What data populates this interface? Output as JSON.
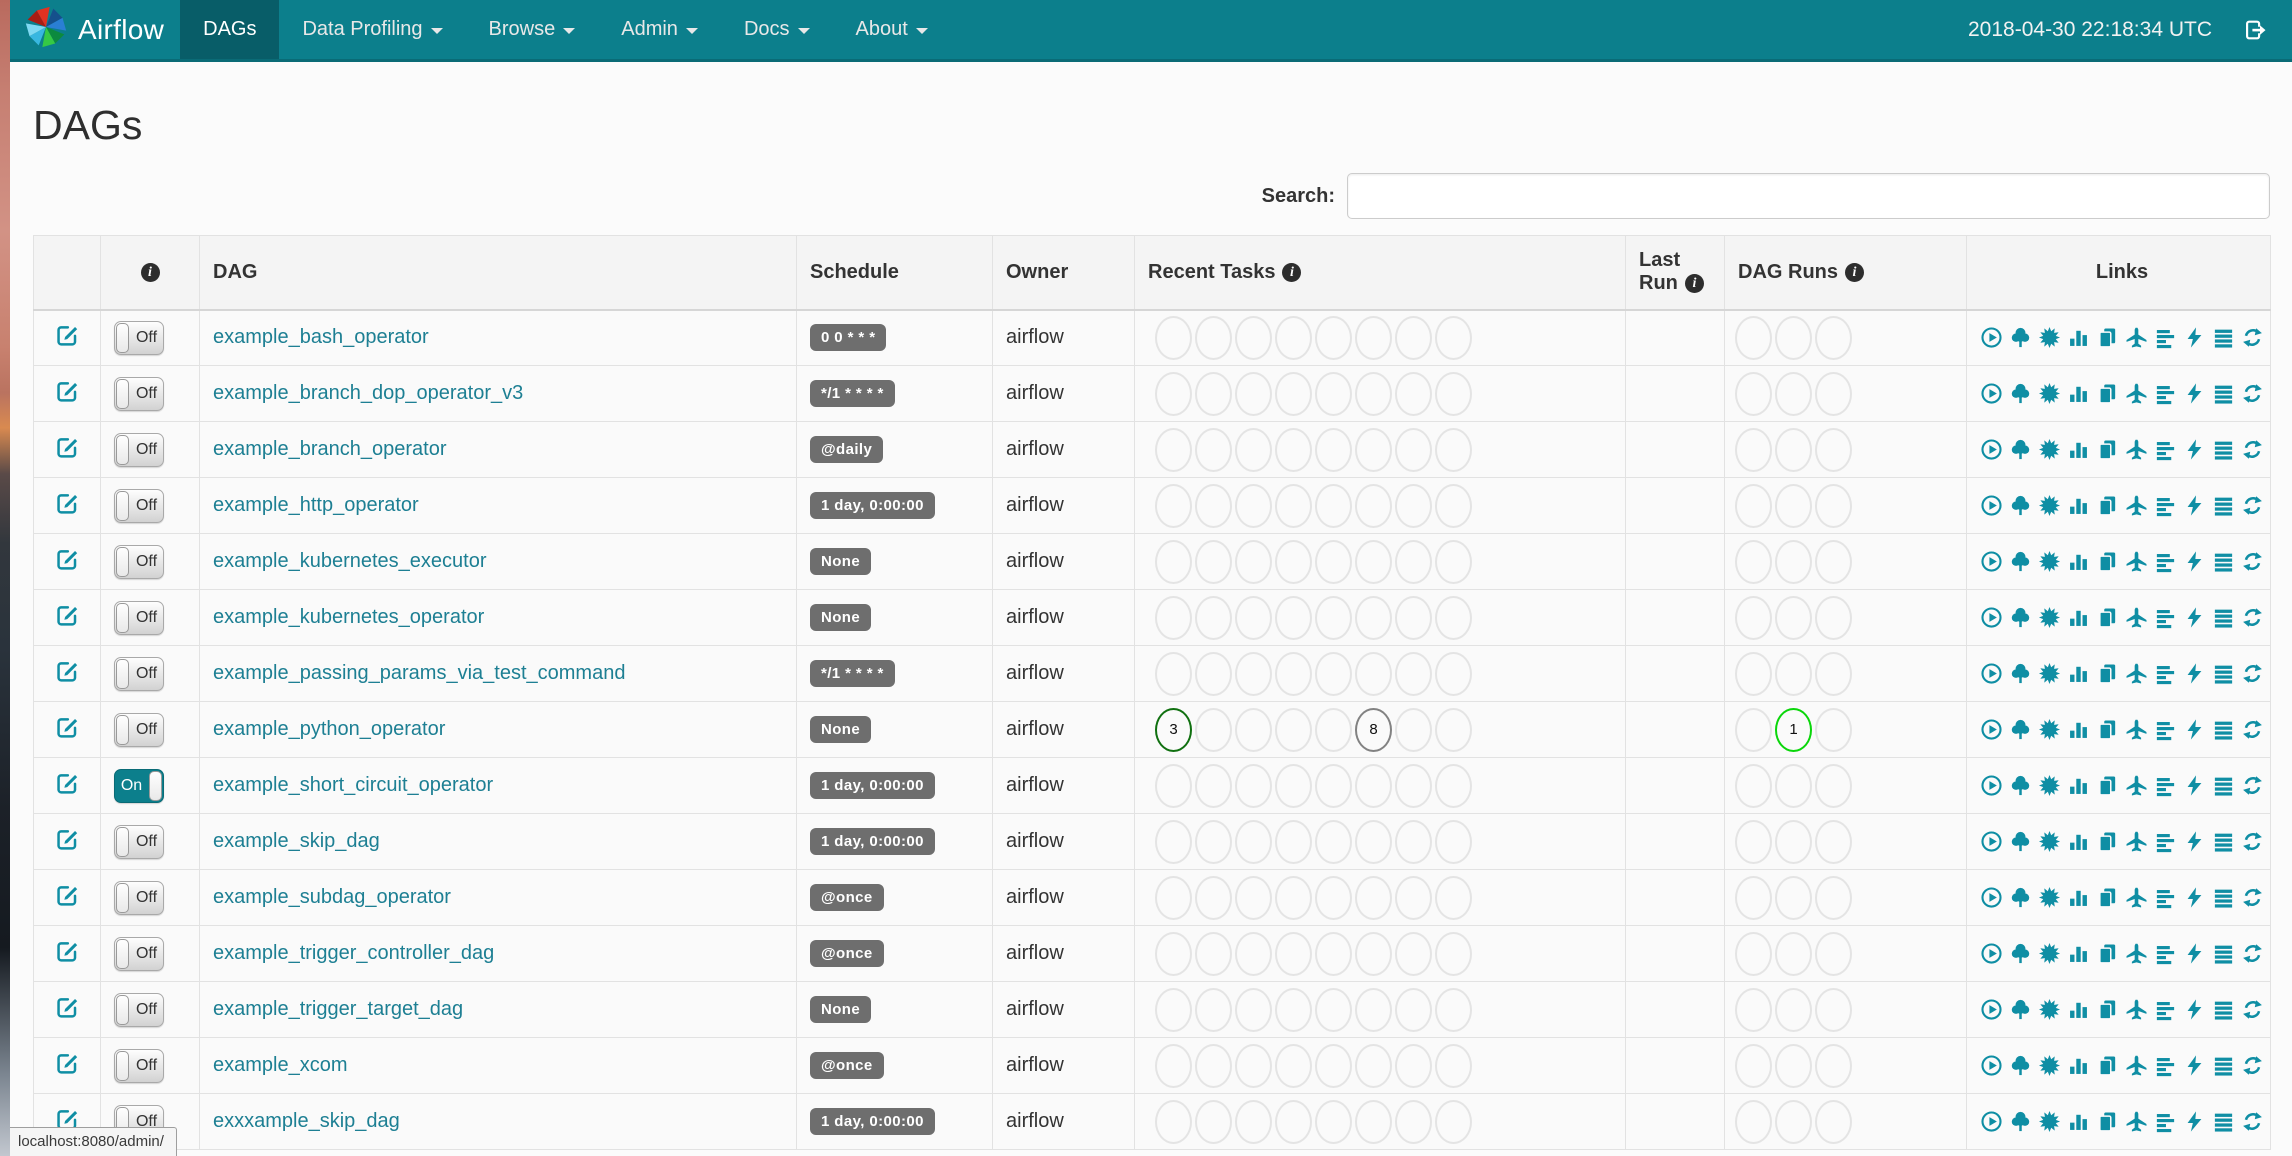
{
  "navbar": {
    "brand": "Airflow",
    "items": [
      {
        "label": "DAGs",
        "active": true,
        "caret": false
      },
      {
        "label": "Data Profiling",
        "active": false,
        "caret": true
      },
      {
        "label": "Browse",
        "active": false,
        "caret": true
      },
      {
        "label": "Admin",
        "active": false,
        "caret": true
      },
      {
        "label": "Docs",
        "active": false,
        "caret": true
      },
      {
        "label": "About",
        "active": false,
        "caret": true
      }
    ],
    "clock": "2018-04-30 22:18:34 UTC"
  },
  "page": {
    "title": "DAGs",
    "search_label": "Search:",
    "search_value": "",
    "status_bar_url": "localhost:8080/admin/"
  },
  "table": {
    "headers": {
      "edit": "",
      "dag": "DAG",
      "schedule": "Schedule",
      "owner": "Owner",
      "recent_tasks": "Recent Tasks",
      "last_run": "Last Run",
      "dag_runs": "DAG Runs",
      "links": "Links"
    },
    "recent_task_slots": 8,
    "dag_run_slots": 3,
    "rows": [
      {
        "name": "example_bash_operator",
        "toggle": "Off",
        "schedule": "0 0 * * *",
        "owner": "airflow",
        "last_run": "",
        "recent_tasks": [],
        "dag_runs": []
      },
      {
        "name": "example_branch_dop_operator_v3",
        "toggle": "Off",
        "schedule": "*/1 * * * *",
        "owner": "airflow",
        "last_run": "",
        "recent_tasks": [],
        "dag_runs": []
      },
      {
        "name": "example_branch_operator",
        "toggle": "Off",
        "schedule": "@daily",
        "owner": "airflow",
        "last_run": "",
        "recent_tasks": [],
        "dag_runs": []
      },
      {
        "name": "example_http_operator",
        "toggle": "Off",
        "schedule": "1 day, 0:00:00",
        "owner": "airflow",
        "last_run": "",
        "recent_tasks": [],
        "dag_runs": []
      },
      {
        "name": "example_kubernetes_executor",
        "toggle": "Off",
        "schedule": "None",
        "owner": "airflow",
        "last_run": "",
        "recent_tasks": [],
        "dag_runs": []
      },
      {
        "name": "example_kubernetes_operator",
        "toggle": "Off",
        "schedule": "None",
        "owner": "airflow",
        "last_run": "",
        "recent_tasks": [],
        "dag_runs": []
      },
      {
        "name": "example_passing_params_via_test_command",
        "toggle": "Off",
        "schedule": "*/1 * * * *",
        "owner": "airflow",
        "last_run": "",
        "recent_tasks": [],
        "dag_runs": []
      },
      {
        "name": "example_python_operator",
        "toggle": "Off",
        "schedule": "None",
        "owner": "airflow",
        "last_run": "",
        "recent_tasks": [
          {
            "slot": 0,
            "count": "3",
            "color": "#107010"
          },
          {
            "slot": 5,
            "count": "8",
            "color": "#828282"
          }
        ],
        "dag_runs": [
          {
            "slot": 1,
            "count": "1",
            "color": "#0ad60a"
          }
        ]
      },
      {
        "name": "example_short_circuit_operator",
        "toggle": "On",
        "schedule": "1 day, 0:00:00",
        "owner": "airflow",
        "last_run": "",
        "recent_tasks": [],
        "dag_runs": []
      },
      {
        "name": "example_skip_dag",
        "toggle": "Off",
        "schedule": "1 day, 0:00:00",
        "owner": "airflow",
        "last_run": "",
        "recent_tasks": [],
        "dag_runs": []
      },
      {
        "name": "example_subdag_operator",
        "toggle": "Off",
        "schedule": "@once",
        "owner": "airflow",
        "last_run": "",
        "recent_tasks": [],
        "dag_runs": []
      },
      {
        "name": "example_trigger_controller_dag",
        "toggle": "Off",
        "schedule": "@once",
        "owner": "airflow",
        "last_run": "",
        "recent_tasks": [],
        "dag_runs": []
      },
      {
        "name": "example_trigger_target_dag",
        "toggle": "Off",
        "schedule": "None",
        "owner": "airflow",
        "last_run": "",
        "recent_tasks": [],
        "dag_runs": []
      },
      {
        "name": "example_xcom",
        "toggle": "Off",
        "schedule": "@once",
        "owner": "airflow",
        "last_run": "",
        "recent_tasks": [],
        "dag_runs": []
      },
      {
        "name": "exxxample_skip_dag",
        "toggle": "Off",
        "schedule": "1 day, 0:00:00",
        "owner": "airflow",
        "last_run": "",
        "recent_tasks": [],
        "dag_runs": []
      }
    ]
  },
  "links_icons": [
    "trigger-dag-icon",
    "tree-view-icon",
    "graph-view-icon",
    "task-duration-icon",
    "task-tries-icon",
    "landing-times-icon",
    "gantt-view-icon",
    "code-view-icon",
    "logs-icon",
    "refresh-icon"
  ],
  "colors": {
    "navbar": "#0c7f8c",
    "nav_active": "#085d68",
    "link": "#1d7f93",
    "icon": "#0f8ea4",
    "badge_bg": "#6e6e6e",
    "state_success_green": "#107010",
    "state_gray": "#828282",
    "state_running_lime": "#0ad60a",
    "circle_border": "#e4e4e4"
  }
}
